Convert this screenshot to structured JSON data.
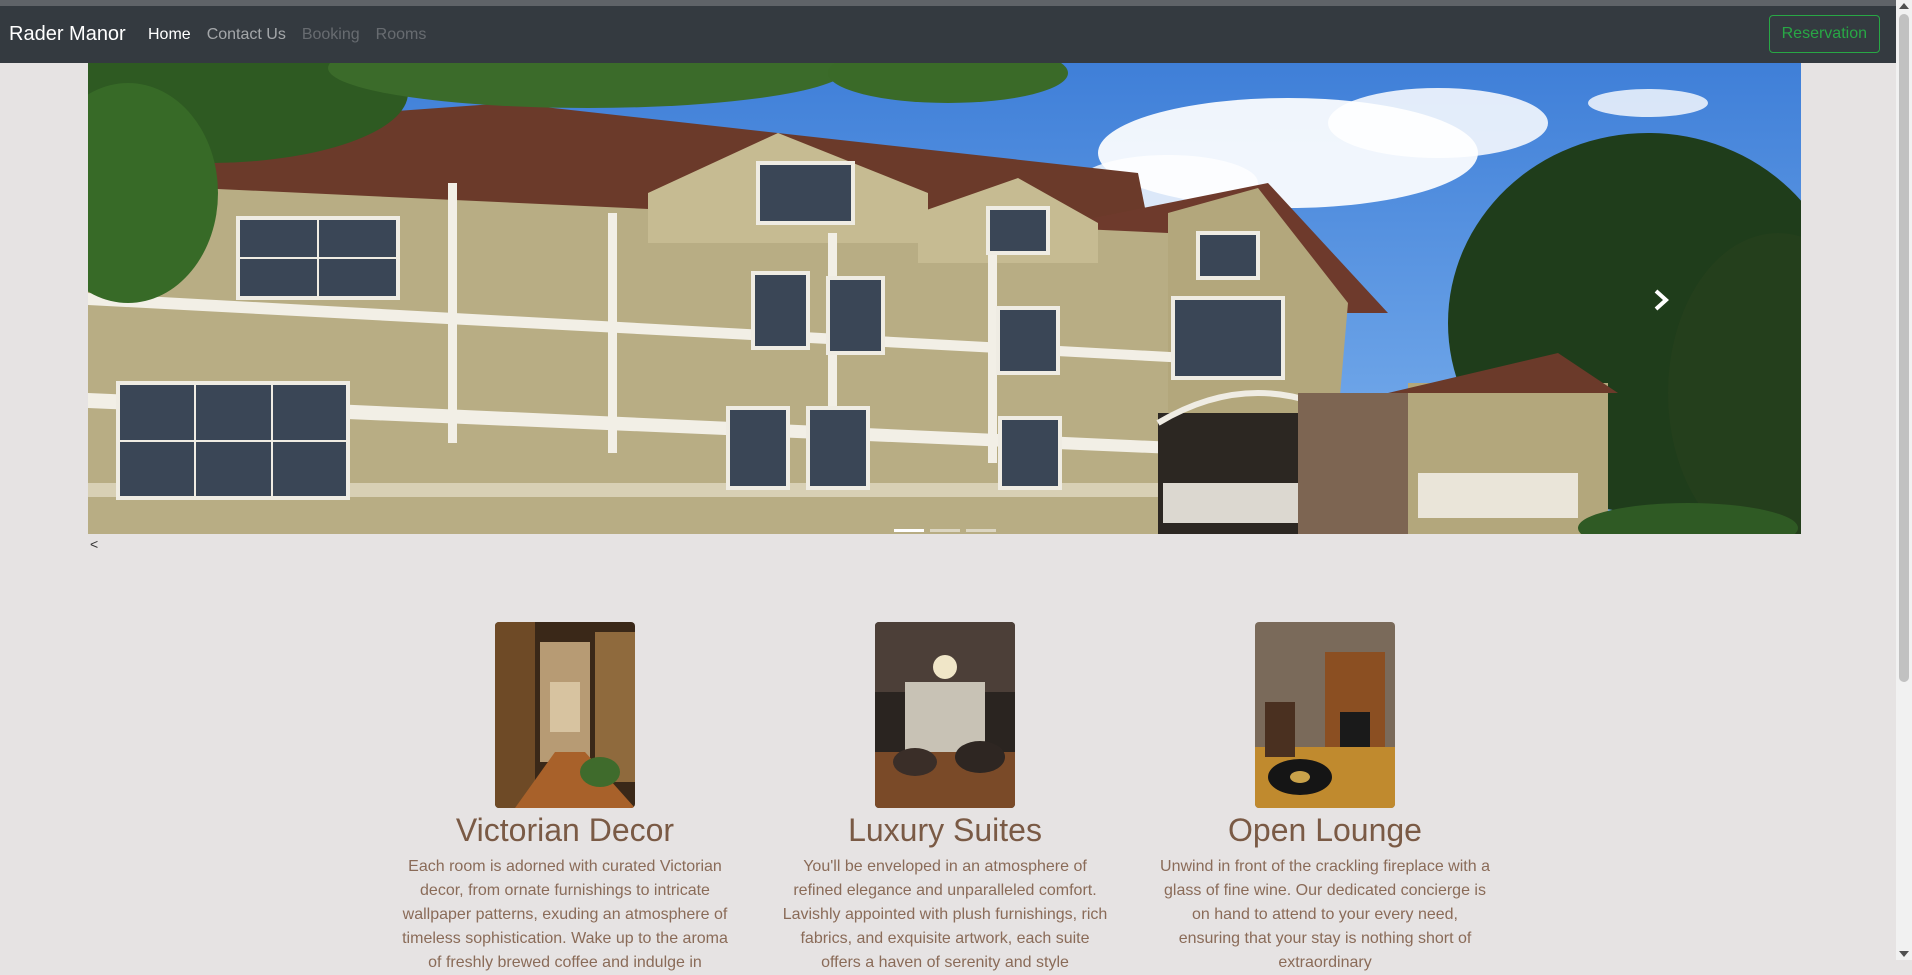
{
  "navbar": {
    "brand": "Rader Manor",
    "links": [
      {
        "label": "Home",
        "state": "active"
      },
      {
        "label": "Contact Us",
        "state": "normal"
      },
      {
        "label": "Booking",
        "state": "disabled"
      },
      {
        "label": "Rooms",
        "state": "disabled"
      }
    ],
    "reservation_label": "Reservation"
  },
  "carousel": {
    "icons": {
      "next": "chevron-right-icon"
    },
    "active_index": 0,
    "indicator_count": 3,
    "prev_label": "<"
  },
  "features": [
    {
      "title": "Victorian Decor",
      "text": "Each room is adorned with curated Victorian decor, from ornate furnishings to intricate wallpaper patterns, exuding an atmosphere of timeless sophistication. Wake up to the aroma of freshly brewed coffee and indulge in"
    },
    {
      "title": "Luxury Suites",
      "text": "You'll be enveloped in an atmosphere of refined elegance and unparalleled comfort. Lavishly appointed with plush furnishings, rich fabrics, and exquisite artwork, each suite offers a haven of serenity and style"
    },
    {
      "title": "Open Lounge",
      "text": "Unwind in front of the crackling fireplace with a glass of fine wine. Our dedicated concierge is on hand to attend to your every need, ensuring that your stay is nothing short of extraordinary"
    }
  ],
  "colors": {
    "navbar_bg": "#343a40",
    "page_bg": "#e6e3e3",
    "accent_green": "#28a745",
    "heading_brown": "#7a5a45"
  }
}
